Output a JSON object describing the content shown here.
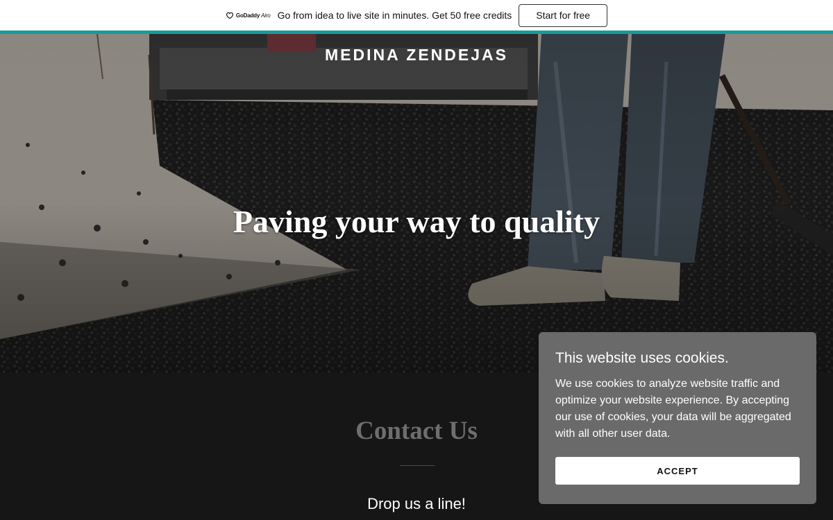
{
  "promo": {
    "logo_icon": "godaddy-heart-icon",
    "logo_brand": "GoDaddy",
    "logo_product": "Airo",
    "message": "Go from idea to live site in minutes. Get 50 free credits",
    "cta_label": "Start for free",
    "accent_color": "#1a9a9a"
  },
  "hero": {
    "site_title": "MEDINA ZENDEJAS",
    "tagline": "Paving your way to quality",
    "image": "asphalt-paving-worker-photo"
  },
  "contact": {
    "title": "Contact Us",
    "subtitle": "Drop us a line!"
  },
  "cookie_dialog": {
    "title": "This website uses cookies.",
    "body": "We use cookies to analyze website traffic and optimize your website experience. By accepting our use of cookies, your data will be aggregated with all other user data.",
    "accept_label": "ACCEPT"
  }
}
